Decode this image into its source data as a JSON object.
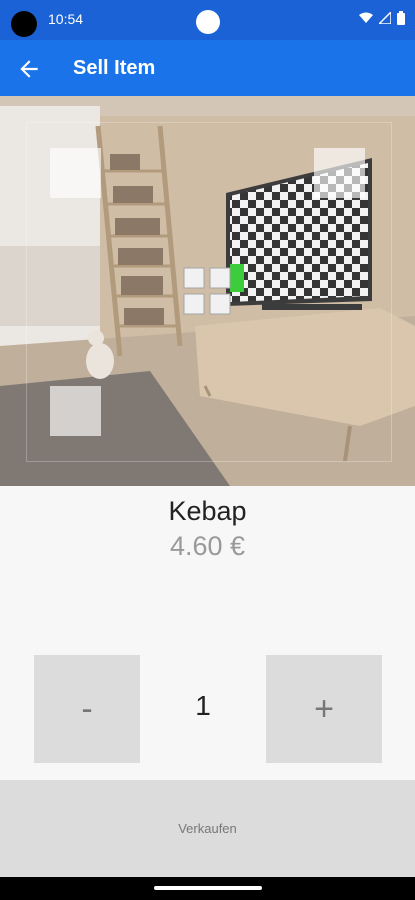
{
  "status_bar": {
    "time": "10:54",
    "icons": [
      "wifi-icon",
      "signal-icon",
      "battery-icon"
    ]
  },
  "app_bar": {
    "title": "Sell Item",
    "back_icon": "arrow-left-icon"
  },
  "product": {
    "name": "Kebap",
    "price": "4.60 €"
  },
  "quantity": {
    "minus_label": "-",
    "value": "1",
    "plus_label": "+"
  },
  "actions": {
    "sell_label": "Verkaufen"
  },
  "colors": {
    "status_bar": "#1a62d6",
    "app_bar": "#1a73e8",
    "button_bg": "#dcdcdc",
    "price_text": "#999999"
  }
}
